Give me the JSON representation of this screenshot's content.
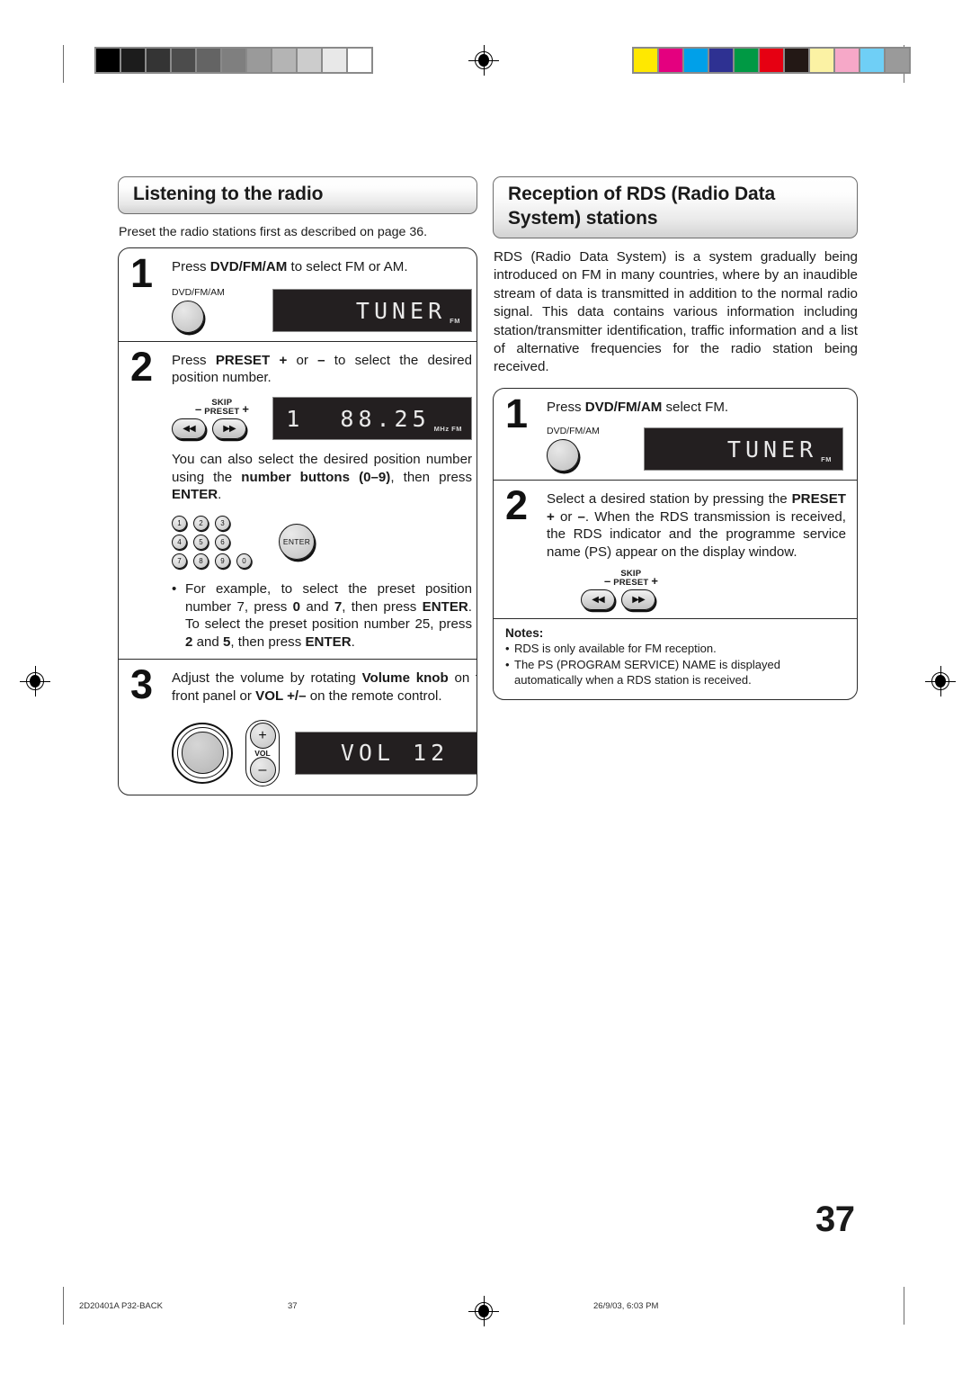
{
  "print_marks": {
    "gray_swatches": [
      "#000000",
      "#1c1c1c",
      "#343434",
      "#4c4c4c",
      "#646464",
      "#7f7f7f",
      "#9a9a9a",
      "#b4b4b4",
      "#cccccc",
      "#e8e8e8",
      "#ffffff"
    ],
    "color_swatches": [
      "#ffe800",
      "#e4007f",
      "#00a0e9",
      "#2e3192",
      "#009944",
      "#e60012",
      "#231815",
      "#fbf2a4",
      "#f6a8c8",
      "#6fcff6",
      "#9a9a9a"
    ]
  },
  "left_column": {
    "heading": "Listening to the radio",
    "intro": "Preset the radio stations first as described on page 36.",
    "steps": [
      {
        "number": "1",
        "text_parts": [
          {
            "t": "Press ",
            "b": false
          },
          {
            "t": "DVD/FM/AM",
            "b": true
          },
          {
            "t": " to select FM or AM.",
            "b": false
          }
        ],
        "button_label": "DVD/FM/AM",
        "display": {
          "text": "TUNER",
          "indicator": "FM"
        }
      },
      {
        "number": "2",
        "text_parts": [
          {
            "t": "Press ",
            "b": false
          },
          {
            "t": "PRESET +",
            "b": true
          },
          {
            "t": " or ",
            "b": false
          },
          {
            "t": "–",
            "b": true
          },
          {
            "t": "  to select the desired position number.",
            "b": false
          }
        ],
        "skip_labels": {
          "minus": "–",
          "top": "SKIP",
          "bottom": "PRESET",
          "plus": "+"
        },
        "display": {
          "text": "1  88.25",
          "indicator": "MHz FM"
        },
        "sub_text_parts": [
          {
            "t": "You can also select the desired position number using the ",
            "b": false
          },
          {
            "t": "number buttons (0–9)",
            "b": true
          },
          {
            "t": ", then press ",
            "b": false
          },
          {
            "t": "ENTER",
            "b": true
          },
          {
            "t": ".",
            "b": false
          }
        ],
        "keypad": [
          "1",
          "2",
          "3",
          "4",
          "5",
          "6",
          "7",
          "8",
          "9",
          "0"
        ],
        "enter_label": "ENTER",
        "bullet_parts": [
          {
            "t": "For example, to select the preset position number 7, press ",
            "b": false
          },
          {
            "t": "0",
            "b": true
          },
          {
            "t": " and ",
            "b": false
          },
          {
            "t": "7",
            "b": true
          },
          {
            "t": ", then press ",
            "b": false
          },
          {
            "t": "ENTER",
            "b": true
          },
          {
            "t": ". To select the preset position number 25, press ",
            "b": false
          },
          {
            "t": "2",
            "b": true
          },
          {
            "t": " and ",
            "b": false
          },
          {
            "t": "5",
            "b": true
          },
          {
            "t": ", then press ",
            "b": false
          },
          {
            "t": "ENTER",
            "b": true
          },
          {
            "t": ".",
            "b": false
          }
        ]
      },
      {
        "number": "3",
        "text_parts": [
          {
            "t": "Adjust the volume by rotating ",
            "b": false
          },
          {
            "t": "Volume knob",
            "b": true
          },
          {
            "t": " on the front panel or ",
            "b": false
          },
          {
            "t": "VOL +/–",
            "b": true
          },
          {
            "t": " on the remote control.",
            "b": false
          }
        ],
        "vol_label": "VOL",
        "vol_plus": "+",
        "vol_minus": "–",
        "display": {
          "text": "VOL 12",
          "indicator": ""
        }
      }
    ]
  },
  "right_column": {
    "heading": "Reception of RDS (Radio Data System) stations",
    "body": "RDS (Radio Data System) is a system gradually being introduced on FM in many countries, where by an inaudible stream of data is transmitted in addition to the normal radio signal. This data contains various information including station/transmitter identification, traffic information and a list of alternative frequencies for the radio station being received.",
    "steps": [
      {
        "number": "1",
        "text_parts": [
          {
            "t": "Press ",
            "b": false
          },
          {
            "t": "DVD/FM/AM",
            "b": true
          },
          {
            "t": " select FM.",
            "b": false
          }
        ],
        "button_label": "DVD/FM/AM",
        "display": {
          "text": "TUNER",
          "indicator": "FM"
        }
      },
      {
        "number": "2",
        "text_parts": [
          {
            "t": "Select a desired station by pressing the ",
            "b": false
          },
          {
            "t": "PRESET +",
            "b": true
          },
          {
            "t": " or ",
            "b": false
          },
          {
            "t": "–",
            "b": true
          },
          {
            "t": ". When the RDS transmission is received, the RDS indicator and the programme service name (PS) appear on the display window.",
            "b": false
          }
        ],
        "skip_labels": {
          "minus": "–",
          "top": "SKIP",
          "bottom": "PRESET",
          "plus": "+"
        }
      }
    ],
    "notes": {
      "title": "Notes:",
      "items": [
        "RDS is only available for FM reception.",
        "The PS (PROGRAM SERVICE) NAME is displayed automatically when a RDS station is received."
      ]
    }
  },
  "page_number": "37",
  "footer": {
    "file": "2D20401A P32-BACK",
    "page": "37",
    "date": "26/9/03, 6:03 PM"
  }
}
